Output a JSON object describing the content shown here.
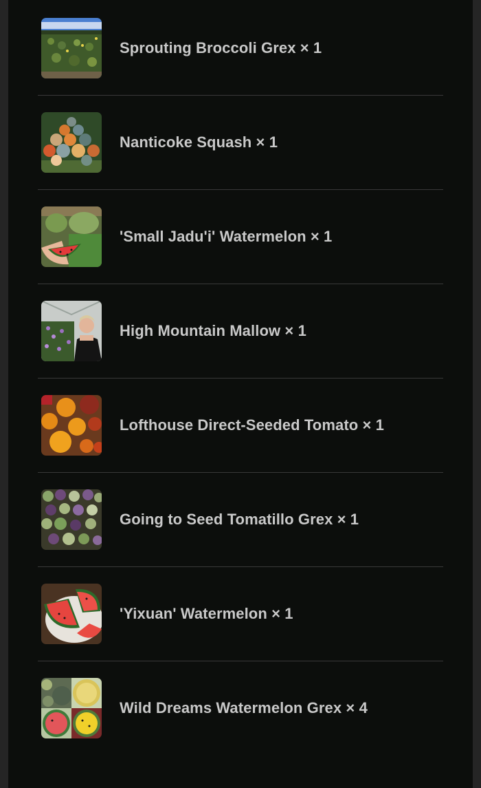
{
  "cart": {
    "items": [
      {
        "name": "Sprouting Broccoli Grex",
        "qty": "× 1",
        "label": "Sprouting Broccoli Grex × 1",
        "image": "broccoli-field-photo"
      },
      {
        "name": "Nanticoke Squash",
        "qty": "× 1",
        "label": "Nanticoke Squash × 1",
        "image": "squash-pile-photo"
      },
      {
        "name": "'Small Jadu'i' Watermelon",
        "qty": "× 1",
        "label": "'Small Jadu'i' Watermelon × 1",
        "image": "watermelon-slice-photo"
      },
      {
        "name": "High Mountain Mallow",
        "qty": "× 1",
        "label": "High Mountain Mallow × 1",
        "image": "mallow-greenhouse-photo"
      },
      {
        "name": "Lofthouse Direct-Seeded Tomato",
        "qty": "× 1",
        "label": "Lofthouse Direct-Seeded Tomato × 1",
        "image": "tomatoes-photo"
      },
      {
        "name": "Going to Seed Tomatillo Grex",
        "qty": "× 1",
        "label": "Going to Seed Tomatillo Grex × 1",
        "image": "tomatillos-photo"
      },
      {
        "name": "'Yixuan' Watermelon",
        "qty": "× 1",
        "label": "'Yixuan' Watermelon × 1",
        "image": "watermelon-plate-photo"
      },
      {
        "name": "Wild Dreams Watermelon Grex",
        "qty": "× 4",
        "label": "Wild Dreams Watermelon Grex × 4",
        "image": "watermelon-collage-photo"
      }
    ]
  },
  "colors": {
    "background": "#0c0e0c",
    "text": "#c9c9c9",
    "divider": "#393939"
  }
}
